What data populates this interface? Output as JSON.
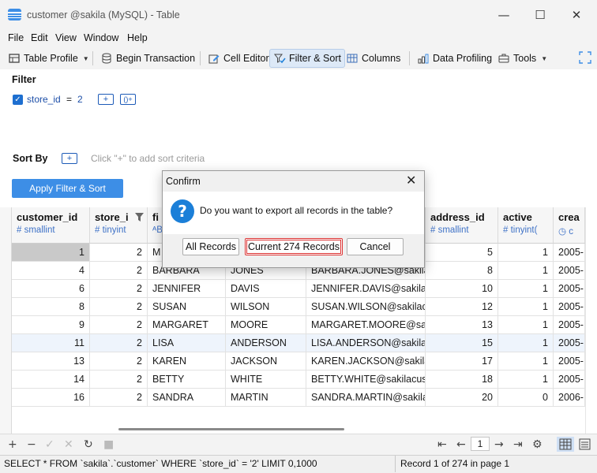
{
  "window": {
    "title": "customer @sakila (MySQL) - Table",
    "min": "—",
    "max": "☐",
    "close": "✕"
  },
  "menu": [
    "File",
    "Edit",
    "View",
    "Window",
    "Help"
  ],
  "toolbar": {
    "table_profile": "Table Profile",
    "begin_transaction": "Begin Transaction",
    "cell_editor": "Cell Editor",
    "filter_sort": "Filter & Sort",
    "columns": "Columns",
    "data_profiling": "Data Profiling",
    "tools": "Tools"
  },
  "filter": {
    "label": "Filter",
    "field": "store_id",
    "op": "=",
    "value": "2",
    "add": "+",
    "group": "()+"
  },
  "sort": {
    "label": "Sort By",
    "add": "+",
    "hint": "Click \"+\" to add sort criteria"
  },
  "apply_label": "Apply Filter & Sort",
  "columns": [
    {
      "name": "customer_id",
      "type": "# smallint"
    },
    {
      "name": "store_i",
      "type": "# tinyint"
    },
    {
      "name": "fi",
      "type": "ᴬB"
    },
    {
      "name": "",
      "type": ""
    },
    {
      "name": "",
      "type": ""
    },
    {
      "name": "address_id",
      "type": "# smallint"
    },
    {
      "name": "active",
      "type": "# tinyint("
    },
    {
      "name": "crea",
      "type": "◷ c"
    }
  ],
  "rows": [
    {
      "customer_id": "1",
      "store_id": "2",
      "first_name": "M",
      "last_name": "",
      "email": "",
      "address_id": "5",
      "active": "1",
      "create_date": "2005-"
    },
    {
      "customer_id": "4",
      "store_id": "2",
      "first_name": "BARBARA",
      "last_name": "JONES",
      "email": "BARBARA.JONES@sakilac",
      "address_id": "8",
      "active": "1",
      "create_date": "2005-"
    },
    {
      "customer_id": "6",
      "store_id": "2",
      "first_name": "JENNIFER",
      "last_name": "DAVIS",
      "email": "JENNIFER.DAVIS@sakilac",
      "address_id": "10",
      "active": "1",
      "create_date": "2005-"
    },
    {
      "customer_id": "8",
      "store_id": "2",
      "first_name": "SUSAN",
      "last_name": "WILSON",
      "email": "SUSAN.WILSON@sakilac",
      "address_id": "12",
      "active": "1",
      "create_date": "2005-"
    },
    {
      "customer_id": "9",
      "store_id": "2",
      "first_name": "MARGARET",
      "last_name": "MOORE",
      "email": "MARGARET.MOORE@sa",
      "address_id": "13",
      "active": "1",
      "create_date": "2005-"
    },
    {
      "customer_id": "11",
      "store_id": "2",
      "first_name": "LISA",
      "last_name": "ANDERSON",
      "email": "LISA.ANDERSON@sakila",
      "address_id": "15",
      "active": "1",
      "create_date": "2005-"
    },
    {
      "customer_id": "13",
      "store_id": "2",
      "first_name": "KAREN",
      "last_name": "JACKSON",
      "email": "KAREN.JACKSON@sakila",
      "address_id": "17",
      "active": "1",
      "create_date": "2005-"
    },
    {
      "customer_id": "14",
      "store_id": "2",
      "first_name": "BETTY",
      "last_name": "WHITE",
      "email": "BETTY.WHITE@sakilacust",
      "address_id": "18",
      "active": "1",
      "create_date": "2005-"
    },
    {
      "customer_id": "16",
      "store_id": "2",
      "first_name": "SANDRA",
      "last_name": "MARTIN",
      "email": "SANDRA.MARTIN@sakila",
      "address_id": "20",
      "active": "0",
      "create_date": "2006-"
    }
  ],
  "dialog": {
    "title": "Confirm",
    "close": "✕",
    "icon": "?",
    "message": "Do you want to export all records in the table?",
    "all_records": "All Records",
    "current_records": "Current 274 Records",
    "cancel": "Cancel"
  },
  "pager": {
    "page": "1"
  },
  "status": {
    "sql": "SELECT * FROM `sakila`.`customer` WHERE `store_id` = '2' LIMIT 0,1000",
    "records": "Record 1 of 274 in page 1"
  }
}
